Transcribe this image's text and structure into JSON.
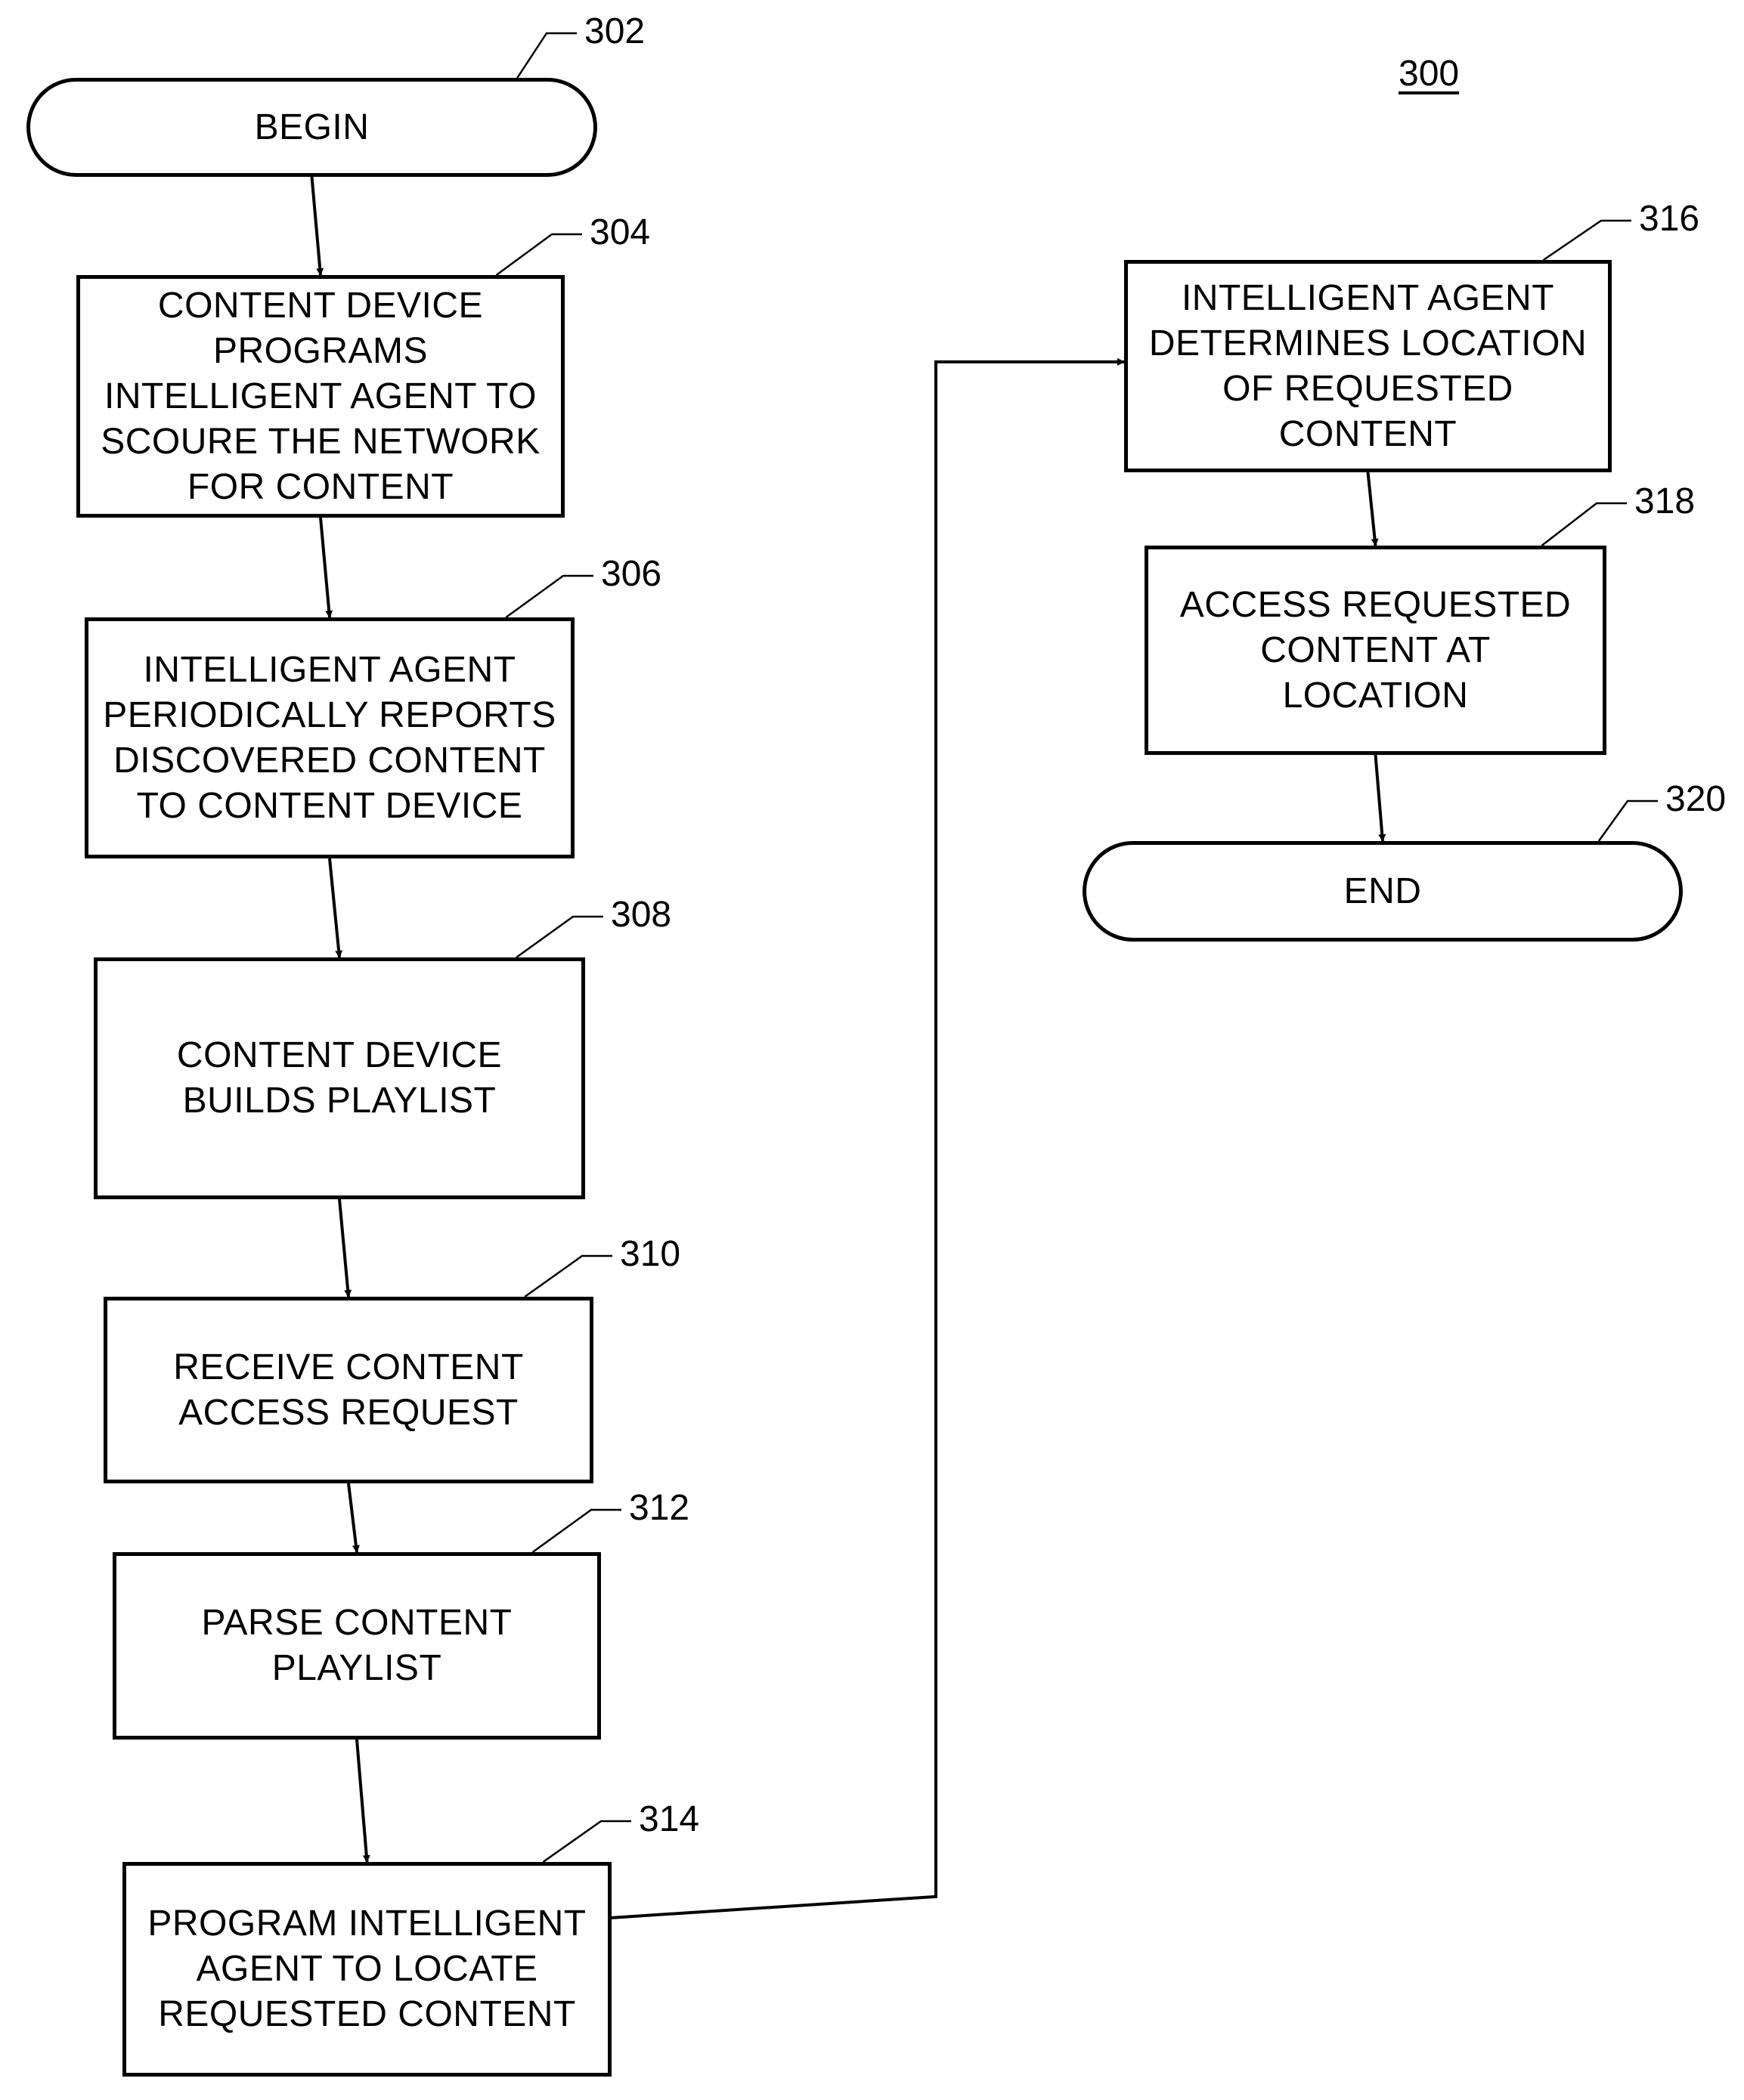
{
  "figure_number": "300",
  "nodes": [
    {
      "id": "302",
      "ref": "302",
      "type": "terminal",
      "text": "BEGIN"
    },
    {
      "id": "304",
      "ref": "304",
      "type": "process",
      "text": "CONTENT DEVICE\nPROGRAMS\nINTELLIGENT AGENT TO\nSCOURE THE NETWORK\nFOR CONTENT"
    },
    {
      "id": "306",
      "ref": "306",
      "type": "process",
      "text": "INTELLIGENT AGENT\nPERIODICALLY REPORTS\nDISCOVERED CONTENT\nTO CONTENT DEVICE"
    },
    {
      "id": "308",
      "ref": "308",
      "type": "process",
      "text": "CONTENT DEVICE\nBUILDS PLAYLIST"
    },
    {
      "id": "310",
      "ref": "310",
      "type": "process",
      "text": "RECEIVE CONTENT\nACCESS REQUEST"
    },
    {
      "id": "312",
      "ref": "312",
      "type": "process",
      "text": "PARSE CONTENT\nPLAYLIST"
    },
    {
      "id": "314",
      "ref": "314",
      "type": "process",
      "text": "PROGRAM INTELLIGENT\nAGENT TO LOCATE\nREQUESTED CONTENT"
    },
    {
      "id": "316",
      "ref": "316",
      "type": "process",
      "text": "INTELLIGENT AGENT\nDETERMINES LOCATION\nOF REQUESTED\nCONTENT"
    },
    {
      "id": "318",
      "ref": "318",
      "type": "process",
      "text": "ACCESS REQUESTED\nCONTENT AT\nLOCATION"
    },
    {
      "id": "320",
      "ref": "320",
      "type": "terminal",
      "text": "END"
    }
  ],
  "edges": [
    {
      "from": "302",
      "to": "304"
    },
    {
      "from": "304",
      "to": "306"
    },
    {
      "from": "306",
      "to": "308"
    },
    {
      "from": "308",
      "to": "310"
    },
    {
      "from": "310",
      "to": "312"
    },
    {
      "from": "312",
      "to": "314"
    },
    {
      "from": "314",
      "to": "316"
    },
    {
      "from": "316",
      "to": "318"
    },
    {
      "from": "318",
      "to": "320"
    }
  ]
}
